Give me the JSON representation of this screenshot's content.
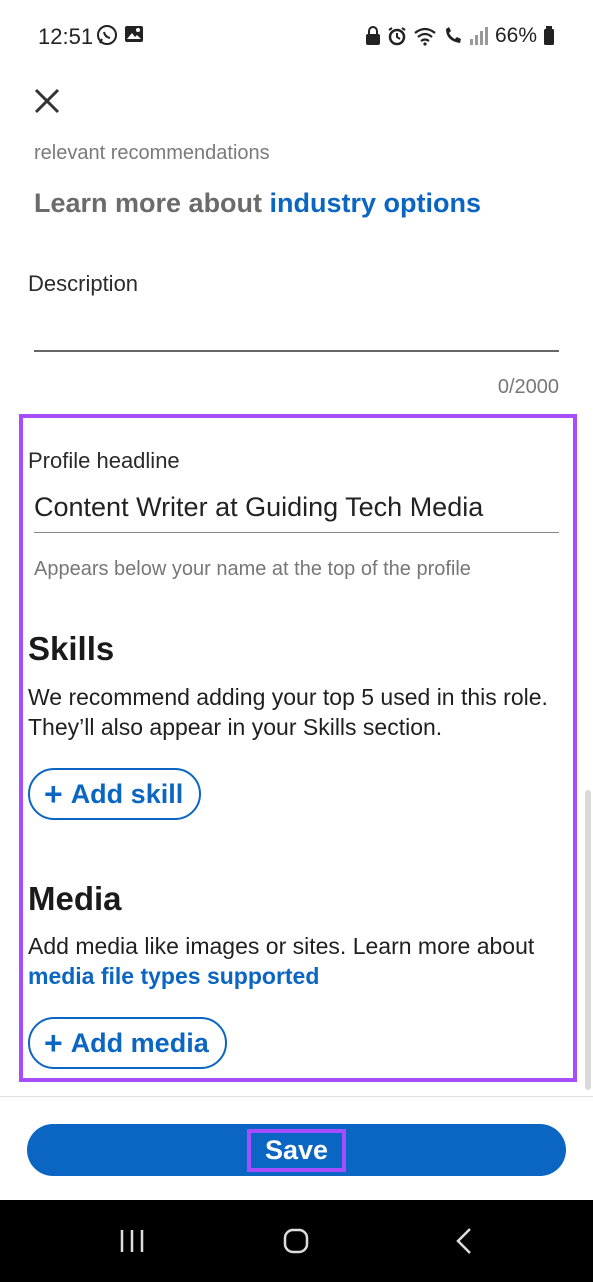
{
  "status": {
    "time": "12:51",
    "battery": "66%",
    "icons_left": [
      "whatsapp-icon",
      "gallery-icon"
    ],
    "icons_right": [
      "lock-icon",
      "alarm-icon",
      "wifi-icon",
      "volte-call-icon",
      "signal-icon",
      "battery-icon"
    ]
  },
  "form": {
    "faded_text": "relevant recommendations",
    "learn_more_prefix": "Learn more about ",
    "learn_more_link": "industry options",
    "description_label": "Description",
    "description_counter": "0/2000",
    "headline_label": "Profile headline",
    "headline_value": "Content Writer at Guiding Tech Media",
    "headline_hint": "Appears below your name at the top of the profile"
  },
  "skills": {
    "title": "Skills",
    "body": "We recommend adding your top 5 used in this role. They’ll also appear in your Skills section.",
    "add_label": "Add skill"
  },
  "media": {
    "title": "Media",
    "body_prefix": "Add media like images or sites. Learn more about ",
    "body_link": "media file types supported",
    "add_label": "Add media"
  },
  "footer": {
    "save_label": "Save"
  },
  "colors": {
    "accent": "#0a66c2",
    "highlight": "#a64dff"
  }
}
